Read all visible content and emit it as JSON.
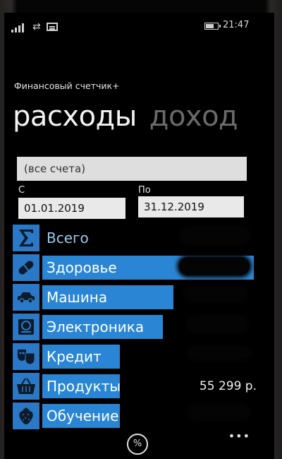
{
  "status": {
    "time": "21:47",
    "battery_level": 0.7
  },
  "app": {
    "title": "Финансовый счетчик+"
  },
  "pivot": {
    "active": "расходы",
    "next": "доход"
  },
  "filter": {
    "account": "(все счета)",
    "from_label": "С",
    "from_date": "01.01.2019",
    "to_label": "По",
    "to_date": "31.12.2019"
  },
  "categories": [
    {
      "label": "Всего",
      "icon": "sigma-icon",
      "amount": "",
      "bar_fraction": 0.0
    },
    {
      "label": "Здоровье",
      "icon": "pill-icon",
      "amount": "",
      "bar_fraction": 1.0
    },
    {
      "label": "Машина",
      "icon": "car-icon",
      "amount": "",
      "bar_fraction": 0.62
    },
    {
      "label": "Электроника",
      "icon": "hard-drive-icon",
      "amount": "",
      "bar_fraction": 0.57
    },
    {
      "label": "Кредит",
      "icon": "theater-masks-icon",
      "amount": "",
      "bar_fraction": 0.31
    },
    {
      "label": "Продукты",
      "icon": "basket-icon",
      "amount": "55 299 р.",
      "bar_fraction": 0.27
    },
    {
      "label": "Обучение",
      "icon": "strawberry-icon",
      "amount": "",
      "bar_fraction": 0.26
    }
  ],
  "appbar": {
    "percent_label": "%",
    "more_label": "•••"
  },
  "colors": {
    "accent": "#2a86d4",
    "icon_bg": "#2a78c6"
  }
}
